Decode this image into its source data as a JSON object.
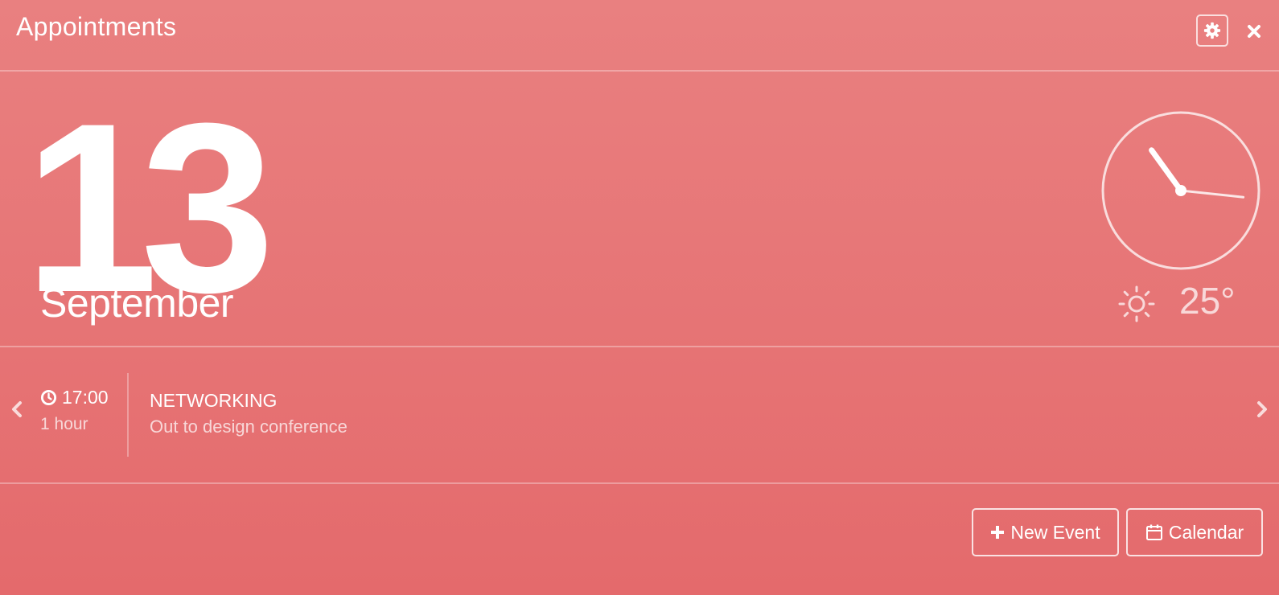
{
  "header": {
    "title": "Appointments",
    "settings_icon": "gear-icon",
    "close_icon": "close-icon"
  },
  "date": {
    "day": "13",
    "month": "September"
  },
  "clock": {
    "hour_hand_pointing_to_hour": 10.8,
    "minute_hand_pointing_to_minute": 16
  },
  "weather": {
    "icon": "sun-icon",
    "temperature": "25°"
  },
  "event": {
    "time": "17:00",
    "duration": "1 hour",
    "title": "NETWORKING",
    "description": "Out to design conference",
    "time_icon": "clock-icon",
    "prev_icon": "chevron-left-icon",
    "next_icon": "chevron-right-icon"
  },
  "actions": {
    "new_event_label": "New Event",
    "new_event_icon": "plus-icon",
    "calendar_label": "Calendar",
    "calendar_icon": "calendar-icon"
  },
  "colors": {
    "background_top": "#e98080",
    "background_bottom": "#e46a6c",
    "foreground": "#ffffff"
  }
}
